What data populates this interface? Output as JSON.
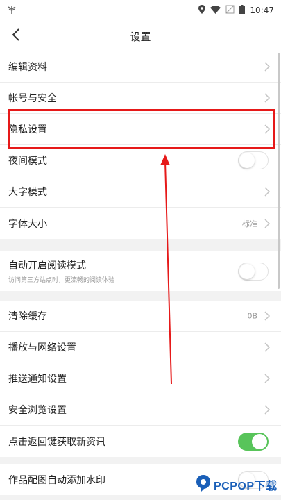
{
  "status": {
    "time": "10:47"
  },
  "header": {
    "title": "设置",
    "back_icon": "chevron-left-icon"
  },
  "groups": [
    {
      "items": [
        {
          "label": "编辑资料",
          "control": "chevron"
        },
        {
          "label": "帐号与安全",
          "control": "chevron"
        },
        {
          "label": "隐私设置",
          "control": "chevron"
        },
        {
          "label": "夜间模式",
          "control": "toggle",
          "on": false
        },
        {
          "label": "大字模式",
          "control": "chevron"
        },
        {
          "label": "字体大小",
          "control": "chevron",
          "value": "标准"
        }
      ]
    },
    {
      "items": [
        {
          "label": "自动开启阅读模式",
          "sub": "访问第三方站点时，更流畅的阅读体验",
          "control": "toggle",
          "on": false
        }
      ]
    },
    {
      "items": [
        {
          "label": "清除缓存",
          "control": "chevron",
          "value": "0B"
        },
        {
          "label": "播放与网络设置",
          "control": "chevron"
        },
        {
          "label": "推送通知设置",
          "control": "chevron"
        },
        {
          "label": "安全浏览设置",
          "control": "chevron"
        },
        {
          "label": "点击返回键获取新资讯",
          "control": "toggle",
          "on": true
        }
      ]
    },
    {
      "items": [
        {
          "label": "作品配图自动添加水印",
          "control": "toggle",
          "on": false
        }
      ]
    }
  ],
  "annotation": {
    "color": "#e61919"
  },
  "watermark": {
    "text": "PCPOP下载"
  },
  "colors": {
    "toggle_on": "#58c45a"
  }
}
